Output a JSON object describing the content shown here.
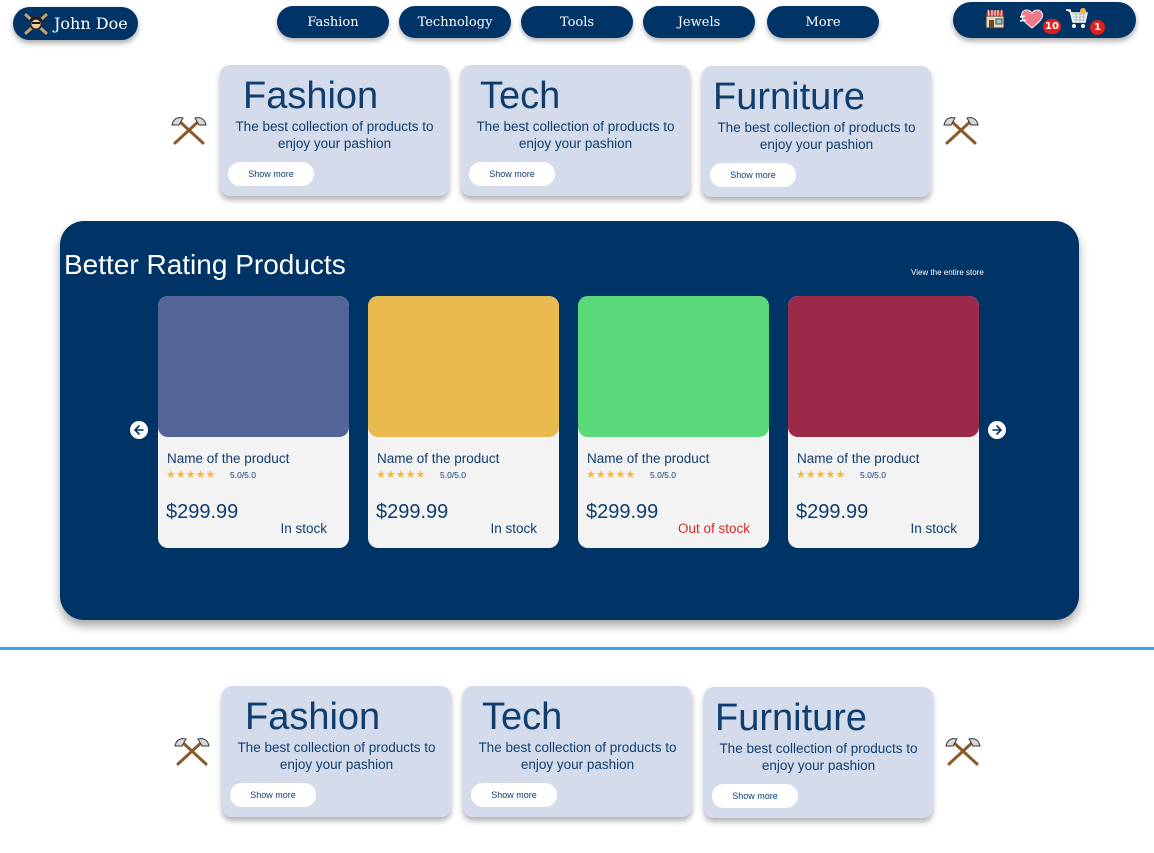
{
  "user": {
    "name": "John Doe",
    "avatar_icon": "pirate-icon"
  },
  "nav": {
    "items": [
      "Fashion",
      "Technology",
      "Tools",
      "Jewels",
      "More"
    ]
  },
  "header_icons": {
    "store_icon": "store-icon",
    "wishlist_icon": "heart-icon",
    "wishlist_count": "10",
    "cart_icon": "cart-icon",
    "cart_count": "1"
  },
  "categories_top": [
    {
      "title": "Fashion",
      "description": "The best collection of products to enjoy your pashion",
      "button": "Show more"
    },
    {
      "title": "Tech",
      "description": "The best collection of products to enjoy your pashion",
      "button": "Show more"
    },
    {
      "title": "Furniture",
      "description": "The best collection of products to enjoy your pashion",
      "button": "Show more"
    }
  ],
  "categories_bottom": [
    {
      "title": "Fashion",
      "description": "The best collection of products to enjoy your pashion",
      "button": "Show more"
    },
    {
      "title": "Tech",
      "description": "The best collection of products to enjoy your pashion",
      "button": "Show more"
    },
    {
      "title": "Furniture",
      "description": "The best collection of products to enjoy your pashion",
      "button": "Show more"
    }
  ],
  "rating_section": {
    "title": "Better Rating Products",
    "view_store": "View the entire store",
    "products": [
      {
        "name": "Name of the product",
        "stars": "★★★★★",
        "rating": "5.0/5.0",
        "price": "$299.99",
        "stock": "In stock",
        "color": "#536496"
      },
      {
        "name": "Name of the product",
        "stars": "★★★★★",
        "rating": "5.0/5.0",
        "price": "$299.99",
        "stock": "In stock",
        "color": "#e9ba4d"
      },
      {
        "name": "Name of the product",
        "stars": "★★★★★",
        "rating": "5.0/5.0",
        "price": "$299.99",
        "stock": "Out of stock",
        "color": "#5ad97a"
      },
      {
        "name": "Name of the product",
        "stars": "★★★★★",
        "rating": "5.0/5.0",
        "price": "$299.99",
        "stock": "In stock",
        "color": "#9b2a4a"
      }
    ]
  },
  "colors": {
    "navy": "#003366",
    "card_bg": "#d4dcec",
    "divider": "#3ea0f2",
    "out_of_stock": "#d52b2b",
    "star": "#f4b63d"
  }
}
